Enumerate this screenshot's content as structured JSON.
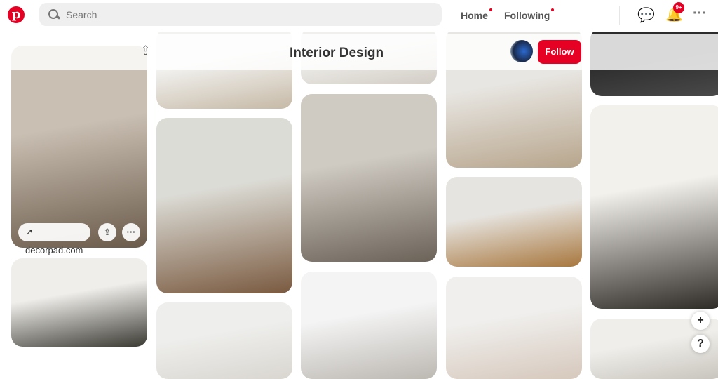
{
  "header": {
    "search_placeholder": "Search",
    "nav": [
      {
        "label": "Home"
      },
      {
        "label": "Following"
      }
    ],
    "notification_badge": "9+",
    "accent": "#e60023"
  },
  "board": {
    "title": "Interior Design",
    "follow_label": "Follow"
  },
  "pin_overlay": {
    "source_label": "decorpad.com"
  },
  "pins": [
    {
      "column": 1,
      "colors": [
        "#c9bfb2",
        "#6a5a4a"
      ]
    },
    {
      "column": 1,
      "colors": [
        "#efeeea",
        "#3b3a33"
      ]
    },
    {
      "column": 2,
      "colors": [
        "#f2f2f0",
        "#c6b9a6"
      ]
    },
    {
      "column": 2,
      "colors": [
        "#dcdcd6",
        "#7a5a40"
      ]
    },
    {
      "column": 2,
      "colors": [
        "#eeeeec",
        "#d9d6d0"
      ]
    },
    {
      "column": 3,
      "colors": [
        "#f0efec",
        "#d2cdc5"
      ]
    },
    {
      "column": 3,
      "colors": [
        "#cfcac2",
        "#6b6258"
      ]
    },
    {
      "column": 3,
      "colors": [
        "#f4f4f4",
        "#bcb8b2"
      ]
    },
    {
      "column": 4,
      "colors": [
        "#e8e6e2",
        "#b7a58c"
      ]
    },
    {
      "column": 4,
      "colors": [
        "#e6e4e0",
        "#a8773e"
      ]
    },
    {
      "column": 4,
      "colors": [
        "#f0efed",
        "#d6c8bc"
      ]
    },
    {
      "column": 5,
      "colors": [
        "#2c2c2c",
        "#4a4a4a"
      ]
    },
    {
      "column": 5,
      "colors": [
        "#f3f1ec",
        "#2e2a26"
      ]
    },
    {
      "column": 5,
      "colors": [
        "#efeeea",
        "#c8c4bd"
      ]
    }
  ],
  "fab": {
    "plus": "+",
    "help": "?"
  }
}
